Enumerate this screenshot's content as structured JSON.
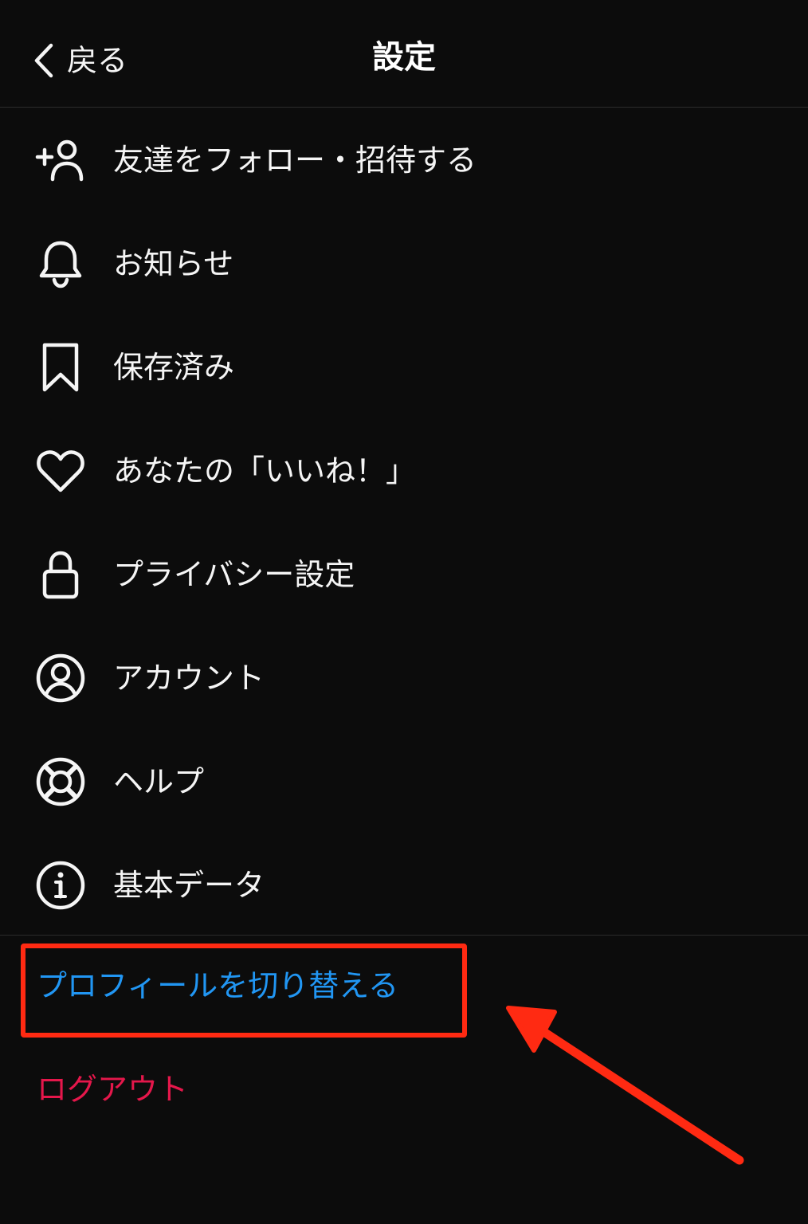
{
  "header": {
    "back_label": "戻る",
    "title": "設定"
  },
  "menu": {
    "items": [
      {
        "label": "友達をフォロー・招待する",
        "icon": "add-user-icon"
      },
      {
        "label": "お知らせ",
        "icon": "bell-icon"
      },
      {
        "label": "保存済み",
        "icon": "bookmark-icon"
      },
      {
        "label": "あなたの「いいね！」",
        "icon": "heart-icon"
      },
      {
        "label": "プライバシー設定",
        "icon": "lock-icon"
      },
      {
        "label": "アカウント",
        "icon": "account-circle-icon"
      },
      {
        "label": "ヘルプ",
        "icon": "lifebuoy-icon"
      },
      {
        "label": "基本データ",
        "icon": "info-icon"
      }
    ]
  },
  "actions": {
    "switch_profile": "プロフィールを切り替える",
    "logout": "ログアウト"
  },
  "colors": {
    "background": "#0c0c0c",
    "text": "#f5f5f5",
    "link_blue": "#2196f3",
    "logout_red": "#e5174b",
    "annotation_red": "#ff2a12"
  }
}
